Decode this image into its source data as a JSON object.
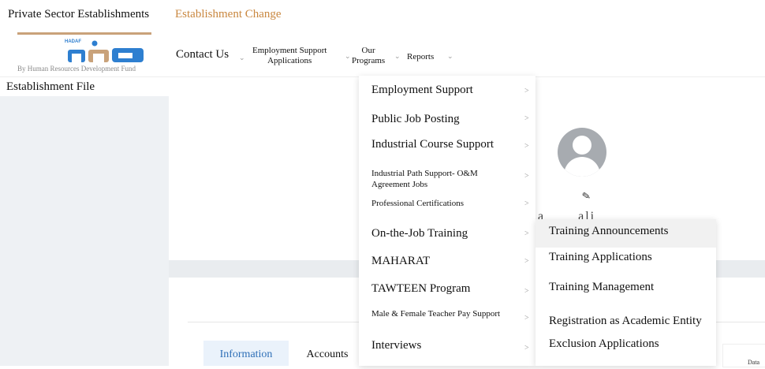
{
  "topbar": {
    "private_sector": "Private Sector Establishments",
    "establishment_change": "Establishment Change"
  },
  "logo": {
    "caption": "By Human Resources Development Fund",
    "wordmark": "HADAF",
    "brand_color": "#2e7fd0",
    "accent_color": "#c9a27a"
  },
  "nav": {
    "contact_us": "Contact Us",
    "employment_support_line1": "Employment Support",
    "employment_support_line2": "Applications",
    "our_programs_line1": "Our",
    "our_programs_line2": "Programs",
    "reports": "Reports"
  },
  "page": {
    "establishment_file": "Establishment File",
    "partial_name": "a       ali"
  },
  "tabs": {
    "information": "Information",
    "accounts": "Accounts",
    "data": "Data"
  },
  "menu": {
    "items": [
      "Employment Support",
      "Public Job Posting",
      "Industrial Course Support",
      "Industrial Path Support- O&M Agreement Jobs",
      "Professional Certifications",
      "On-the-Job Training",
      "MAHARAT",
      "TAWTEEN Program",
      "Male & Female Teacher Pay Support",
      "Interviews"
    ]
  },
  "submenu": {
    "items": [
      "Training Announcements",
      "Training Applications",
      "Training Management",
      "Registration as Academic Entity",
      "Exclusion Applications"
    ]
  }
}
